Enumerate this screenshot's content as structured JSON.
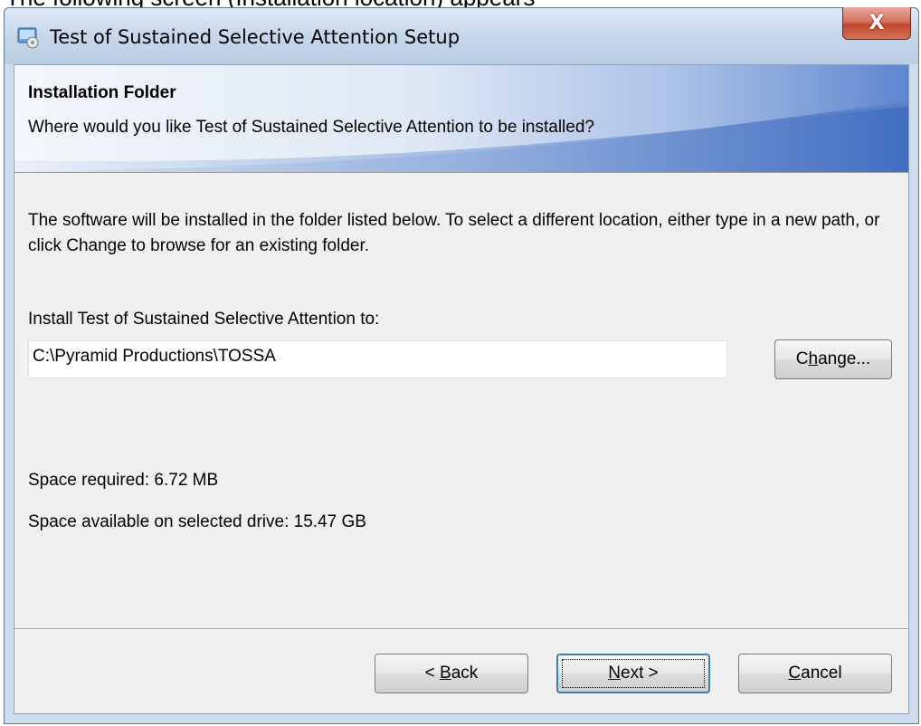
{
  "doc_text": "The following screen (Installation location) appears",
  "window": {
    "title": "Test of Sustained Selective Attention Setup",
    "close_label": "X"
  },
  "banner": {
    "title": "Installation Folder",
    "subtitle": "Where would you like Test of Sustained Selective Attention to be installed?"
  },
  "body": {
    "description": "The software will be installed in the folder listed below. To select a different location, either type in a new path, or click Change to browse for an existing folder.",
    "install_label": "Install Test of Sustained Selective Attention to:",
    "install_path": "C:\\Pyramid Productions\\TOSSA",
    "change_button": {
      "before": "C",
      "mnemonic": "h",
      "after": "ange..."
    },
    "space_required": "Space required: 6.72 MB",
    "space_available": "Space available on selected drive: 15.47 GB"
  },
  "footer": {
    "back_button": {
      "before": "< ",
      "mnemonic": "B",
      "after": "ack"
    },
    "next_button": {
      "before": "",
      "mnemonic": "N",
      "after": "ext >"
    },
    "cancel_button": {
      "before": "",
      "mnemonic": "C",
      "after": "ancel"
    }
  },
  "colors": {
    "banner_blue": "#4f79c5",
    "dialog_bg": "#f0f0f0",
    "close_red": "#c2472e",
    "default_button_border": "#3c7fb1"
  }
}
